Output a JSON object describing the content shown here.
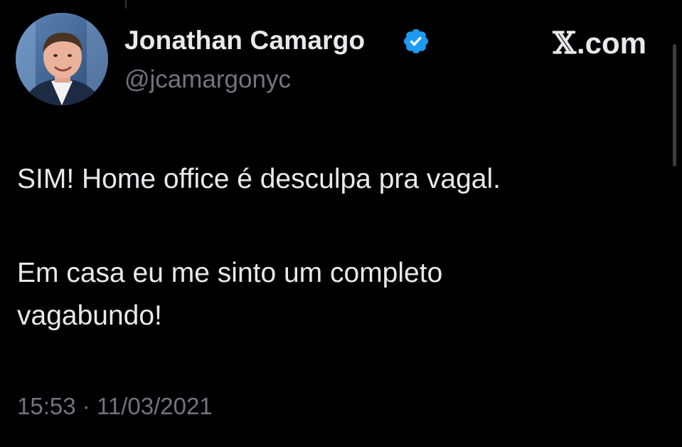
{
  "author": {
    "name": "Jonathan Camargo",
    "handle": "@jcamargonyc",
    "verified": true,
    "badge_color": "#1d9bf0"
  },
  "brand": {
    "icon": "x-logo-icon",
    "label": ".com"
  },
  "tweet": {
    "line1": "SIM! Home office é desculpa pra vagal.",
    "line2": "Em casa eu me sinto um completo",
    "line3": "vagabundo!"
  },
  "timestamp": {
    "time": "15:53",
    "separator": "·",
    "date": "11/03/2021"
  },
  "colors": {
    "background": "#000000",
    "primary_text": "#e7e9ea",
    "secondary_text": "#71767b"
  }
}
